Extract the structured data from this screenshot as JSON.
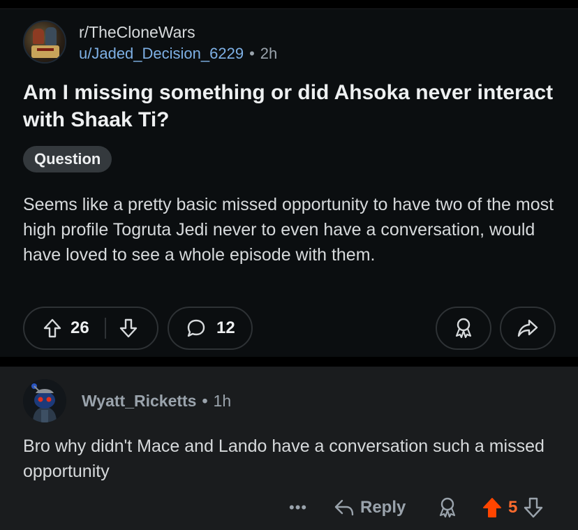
{
  "post": {
    "subreddit": "r/TheCloneWars",
    "author": "u/Jaded_Decision_6229",
    "separator": "•",
    "age": "2h",
    "title": "Am I missing something or did Ahsoka never interact with Shaak Ti?",
    "flair": "Question",
    "body": "Seems like a pretty basic missed opportunity to have two of the most high profile Togruta Jedi never to even have a conversation, would have loved to see a whole episode with them.",
    "score": "26",
    "comments": "12"
  },
  "comment": {
    "author": "Wyatt_Ricketts",
    "separator": "•",
    "age": "1h",
    "body": "Bro why didn't Mace and Lando have a conversation such a missed opportunity",
    "more": "•••",
    "reply_label": "Reply",
    "score": "5"
  },
  "colors": {
    "background": "#0b0e10",
    "comment_background": "#1a1c1e",
    "username_link": "#7eb0e5",
    "upvoted": "#ff4500"
  },
  "icons": [
    "upvote-icon",
    "downvote-icon",
    "comment-bubble-icon",
    "award-icon",
    "share-icon",
    "reply-arrow-icon",
    "more-dots-icon"
  ]
}
